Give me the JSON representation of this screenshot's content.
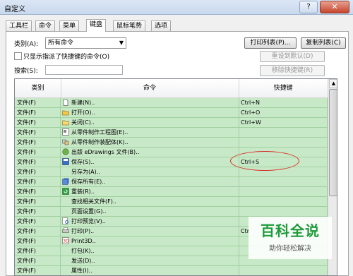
{
  "window": {
    "title": "自定义",
    "help_label": "?",
    "close_label": "✕"
  },
  "tabs": [
    "工具栏",
    "命令",
    "菜单",
    "键盘",
    "鼠标笔势",
    "选项"
  ],
  "filters": {
    "category_label": "类别(A):",
    "category_value": "所有命令",
    "only_shortcuts_label": "只显示指派了快捷键的命令(O)",
    "search_label": "搜索(S):"
  },
  "buttons": {
    "print": "打印列表(P)...",
    "copy": "复制列表(C)",
    "reset": "重设到默认(D)",
    "remove": "移除快捷键(R)"
  },
  "table": {
    "headers": [
      "类别",
      "命令",
      "快捷键"
    ],
    "rows": [
      {
        "category": "文件(F)",
        "icon": "new-document-icon",
        "command": "新建(N)..",
        "shortcut": "Ctrl+N"
      },
      {
        "category": "文件(F)",
        "icon": "open-folder-icon",
        "command": "打开(O)..",
        "shortcut": "Ctrl+O"
      },
      {
        "category": "文件(F)",
        "icon": "close-folder-icon",
        "command": "关闭(C)..",
        "shortcut": "Ctrl+W"
      },
      {
        "category": "文件(F)",
        "icon": "make-drawing-icon",
        "command": "从零件制作工程图(E)..",
        "shortcut": ""
      },
      {
        "category": "文件(F)",
        "icon": "make-assembly-icon",
        "command": "从零件制作装配体(K)..",
        "shortcut": ""
      },
      {
        "category": "文件(F)",
        "icon": "edrawings-icon",
        "command": "出版 eDrawings 文件(B)..",
        "shortcut": ""
      },
      {
        "category": "文件(F)",
        "icon": "save-icon",
        "command": "保存(S)..",
        "shortcut": "Ctrl+S"
      },
      {
        "category": "文件(F)",
        "icon": "",
        "command": "另存为(A)..",
        "shortcut": ""
      },
      {
        "category": "文件(F)",
        "icon": "save-all-icon",
        "command": "保存所有(E)..",
        "shortcut": ""
      },
      {
        "category": "文件(F)",
        "icon": "reload-icon",
        "command": "重装(R)..",
        "shortcut": ""
      },
      {
        "category": "文件(F)",
        "icon": "",
        "command": "查找相关文件(F)..",
        "shortcut": ""
      },
      {
        "category": "文件(F)",
        "icon": "",
        "command": "页面设置(G)..",
        "shortcut": ""
      },
      {
        "category": "文件(F)",
        "icon": "print-preview-icon",
        "command": "打印预览(V)..",
        "shortcut": ""
      },
      {
        "category": "文件(F)",
        "icon": "print-icon",
        "command": "打印(P)..",
        "shortcut": "Ctr"
      },
      {
        "category": "文件(F)",
        "icon": "print3d-icon",
        "command": "Print3D..",
        "shortcut": ""
      },
      {
        "category": "文件(F)",
        "icon": "",
        "command": "打包(K)..",
        "shortcut": ""
      },
      {
        "category": "文件(F)",
        "icon": "",
        "command": "发送(D)..",
        "shortcut": ""
      },
      {
        "category": "文件(F)",
        "icon": "",
        "command": "属性(I)..",
        "shortcut": ""
      }
    ]
  },
  "watermark": {
    "title": "百科全说",
    "subtitle": "助你轻松解决"
  },
  "colors": {
    "row_bg": "#c8e9c8",
    "highlight_ring": "#d9302a",
    "watermark_green": "#1e9b3a"
  }
}
